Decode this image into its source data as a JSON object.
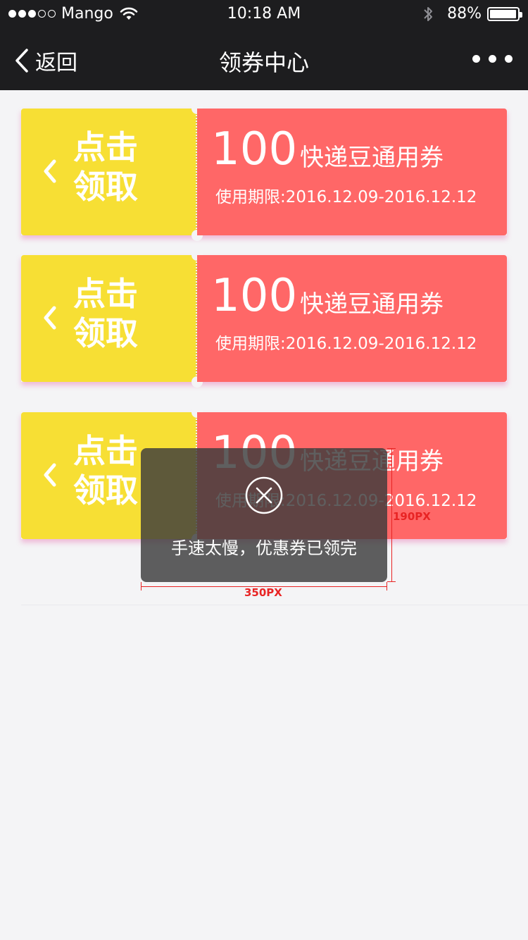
{
  "status_bar": {
    "carrier": "Mango",
    "time": "10:18 AM",
    "battery": "88%",
    "battery_level": 0.88,
    "signal_bars": 3,
    "signal_total": 5
  },
  "nav": {
    "back_label": "返回",
    "title": "领券中心"
  },
  "coupons": [
    {
      "claim_label": "点击领取",
      "amount": "100",
      "description": "快递豆通用券",
      "period": "使用期限:2016.12.09-2016.12.12"
    },
    {
      "claim_label": "点击领取",
      "amount": "100",
      "description": "快递豆通用券",
      "period": "使用期限:2016.12.09-2016.12.12"
    },
    {
      "claim_label": "点击领取",
      "amount": "100",
      "description": "快递豆通用券",
      "period": "使用期限:2016.12.09-2016.12.12"
    }
  ],
  "toast": {
    "message": "手速太慢，优惠券已领完",
    "icon": "close-circle-icon"
  },
  "annotations": {
    "width_label": "350PX",
    "height_label": "190PX"
  },
  "colors": {
    "bar_bg": "#1d1d1f",
    "page_bg": "#f4f4f6",
    "coupon_yellow": "#f7df34",
    "coupon_red": "#ff6767",
    "toast_bg": "#3c3c3c",
    "annotation_red": "#e82424"
  }
}
